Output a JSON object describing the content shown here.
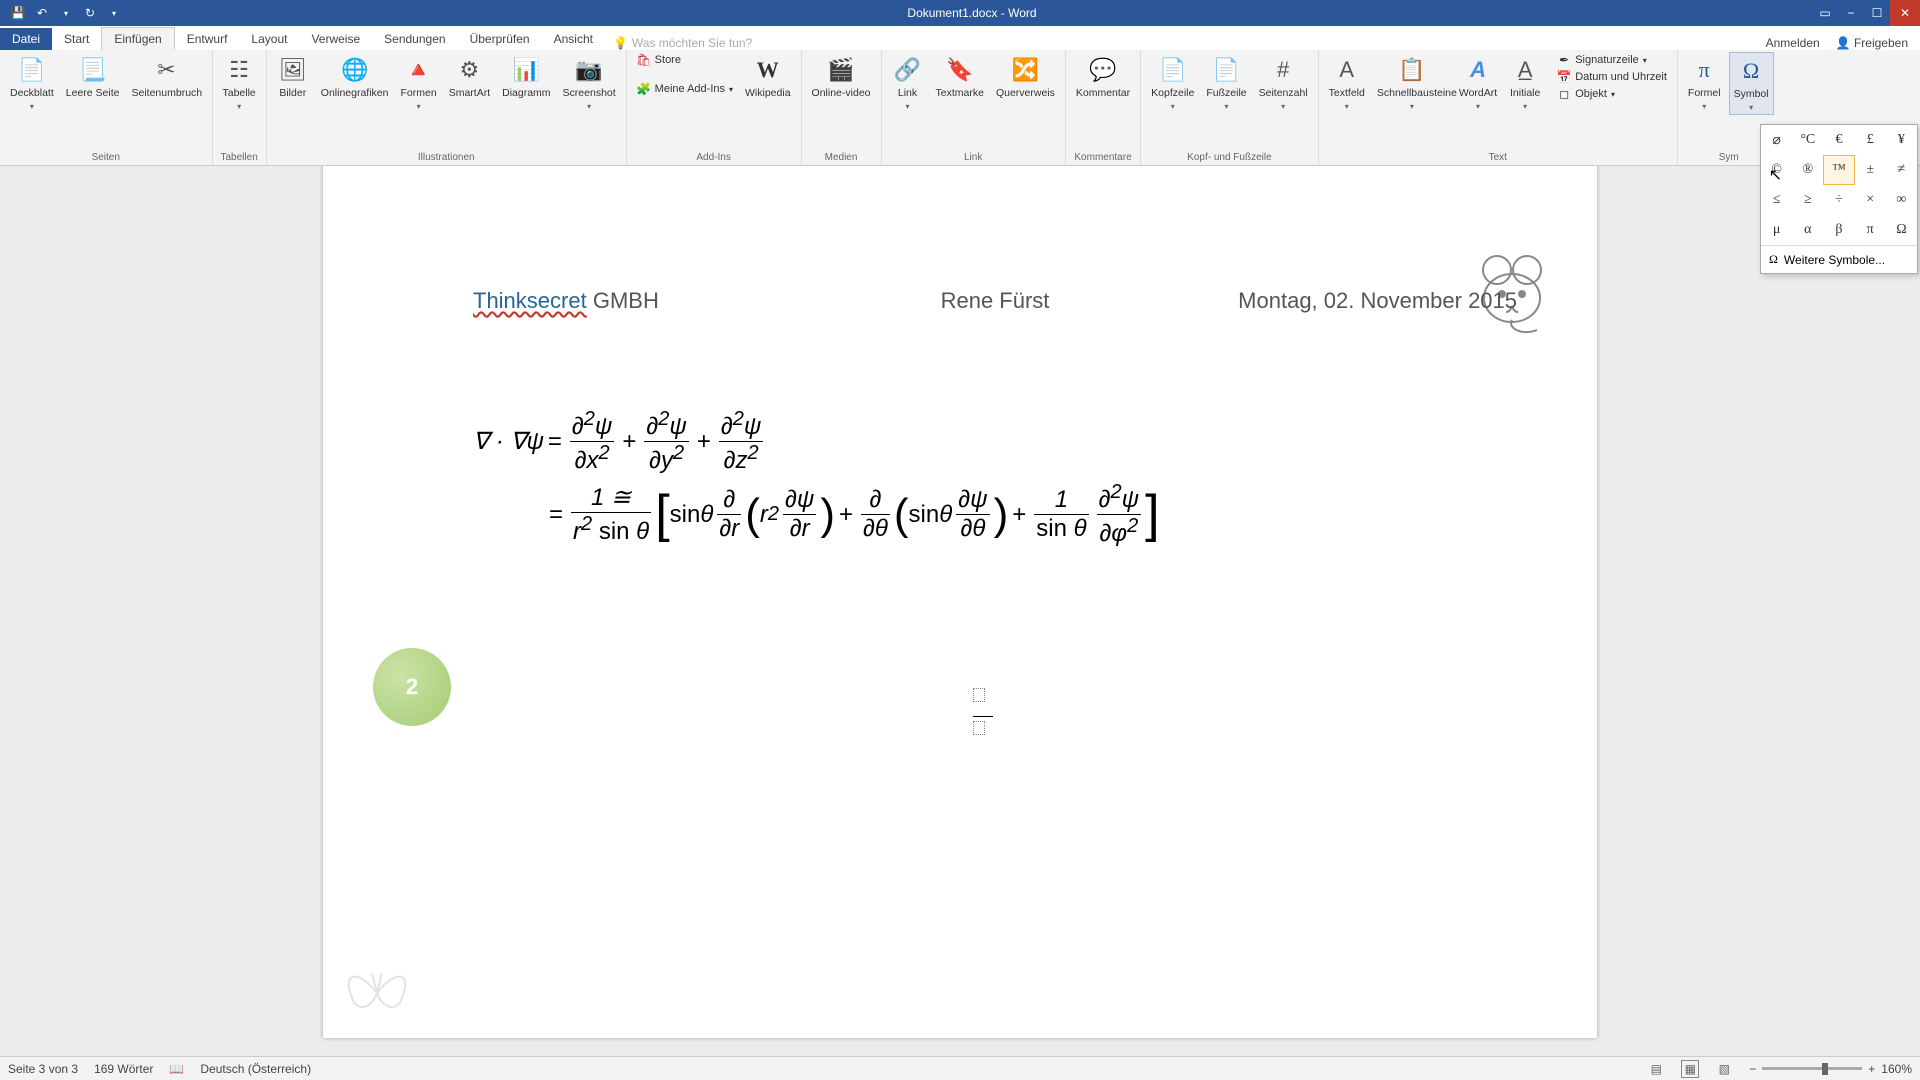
{
  "app": {
    "title": "Dokument1.docx - Word"
  },
  "qat": {
    "save": "💾",
    "undo": "↶",
    "redo": "↻",
    "dd": "▾"
  },
  "winbtns": {
    "ribbonopt": "▭",
    "min": "−",
    "max": "☐",
    "close": "✕"
  },
  "tabs": {
    "file": "Datei",
    "start": "Start",
    "insert": "Einfügen",
    "design": "Entwurf",
    "layout": "Layout",
    "references": "Verweise",
    "mailings": "Sendungen",
    "review": "Überprüfen",
    "view": "Ansicht",
    "tellme": "Was möchten Sie tun?",
    "signin": "Anmelden",
    "share": "Freigeben"
  },
  "ribbon": {
    "pages": {
      "cover": "Deckblatt",
      "blank": "Leere Seite",
      "break": "Seitenumbruch",
      "label": "Seiten"
    },
    "tables": {
      "table": "Tabelle",
      "label": "Tabellen"
    },
    "illus": {
      "pictures": "Bilder",
      "online": "Onlinegrafiken",
      "shapes": "Formen",
      "smartart": "SmartArt",
      "chart": "Diagramm",
      "screenshot": "Screenshot",
      "label": "Illustrationen"
    },
    "addins": {
      "store": "Store",
      "myaddins": "Meine Add-Ins",
      "wikipedia": "Wikipedia",
      "label": "Add-Ins"
    },
    "media": {
      "video": "Online-video",
      "label": "Medien"
    },
    "links": {
      "link": "Link",
      "bookmark": "Textmarke",
      "crossref": "Querverweis",
      "label": "Link"
    },
    "comments": {
      "comment": "Kommentar",
      "label": "Kommentare"
    },
    "hf": {
      "header": "Kopfzeile",
      "footer": "Fußzeile",
      "pagenum": "Seitenzahl",
      "label": "Kopf- und Fußzeile"
    },
    "text": {
      "textbox": "Textfeld",
      "quickparts": "Schnellbausteine",
      "wordart": "WordArt",
      "dropcap": "Initiale",
      "sigline": "Signaturzeile",
      "datetime": "Datum und Uhrzeit",
      "object": "Objekt",
      "label": "Text"
    },
    "symbols": {
      "equation": "Formel",
      "symbol": "Symbol",
      "label": "Sym"
    }
  },
  "symgrid": [
    "⌀",
    "°C",
    "€",
    "£",
    "¥",
    "©",
    "®",
    "™",
    "±",
    "≠",
    "≤",
    "≥",
    "÷",
    "×",
    "∞",
    "μ",
    "α",
    "β",
    "π",
    "Ω"
  ],
  "symgrid_hover_index": 7,
  "symmore": "Weitere Symbole...",
  "doc": {
    "header_company_link": "Thinksecret",
    "header_company_suffix": " GMBH",
    "header_author": "Rene Fürst",
    "header_date": "Montag, 02. November 2015"
  },
  "badge": "2",
  "status": {
    "page": "Seite 3 von 3",
    "words": "169 Wörter",
    "lang": "Deutsch (Österreich)",
    "zoom": "160%"
  }
}
